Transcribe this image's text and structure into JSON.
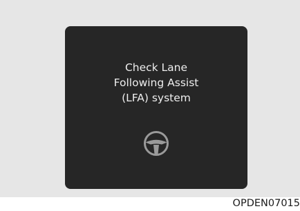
{
  "warning": {
    "line1": "Check Lane",
    "line2": "Following Assist",
    "line3": "(LFA) system",
    "icon": "steering-wheel-icon"
  },
  "figure_code": "OPDEN07015",
  "colors": {
    "page_bg": "#ffffff",
    "panel_bg": "#e6e6e6",
    "display_bg": "#262626",
    "text": "#eeeeee",
    "icon": "#9a9a9a"
  }
}
